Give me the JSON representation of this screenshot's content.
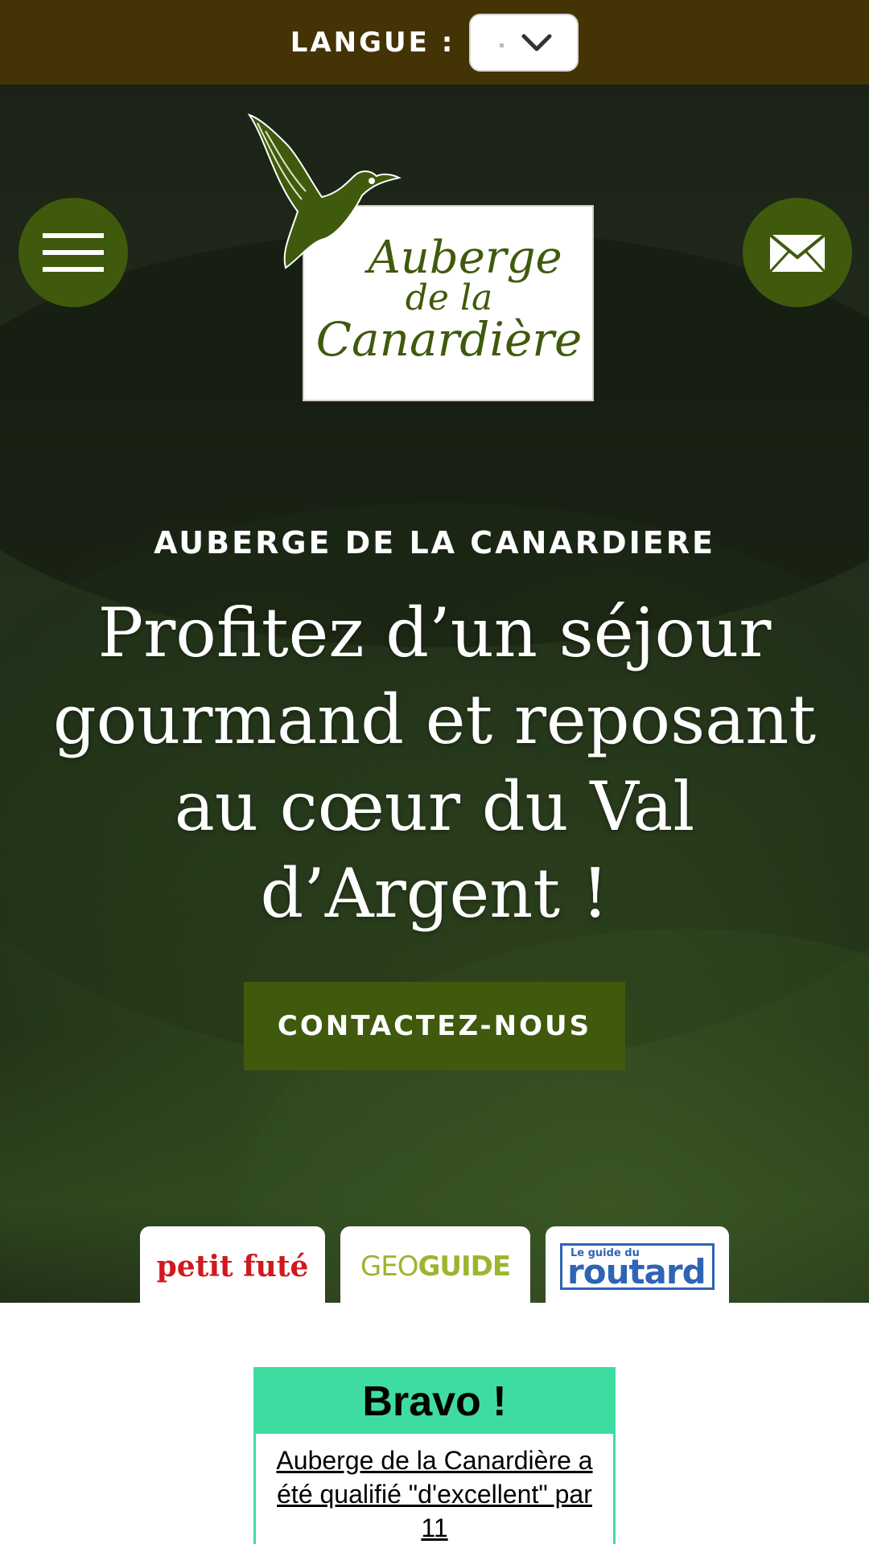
{
  "topbar": {
    "language_label": "LANGUE :",
    "language_select_icon": "chevron-down-icon"
  },
  "header": {
    "menu_icon": "hamburger-icon",
    "contact_icon": "envelope-icon",
    "logo": {
      "line1": "Auberge",
      "line2": "de la",
      "line3": "Canardière"
    }
  },
  "hero": {
    "eyebrow": "AUBERGE DE LA CANARDIERE",
    "headline": "Profitez d’un séjour gourmand et reposant au cœur du Val d’Argent !",
    "cta_label": "CONTACTEZ-NOUS"
  },
  "badges": {
    "petit_fute": "petit futé",
    "geoguide_a": "GEO",
    "geoguide_b": "GUIDE",
    "routard_small": "Le guide du",
    "routard_big": "routard"
  },
  "bravo": {
    "title": "Bravo !",
    "text": "Auberge de la Canardière a été qualifié \"d'excellent\" par 11"
  },
  "colors": {
    "topbar": "#443305",
    "accent_green": "#3f5a0c",
    "bravo_green": "#3fdca2"
  }
}
